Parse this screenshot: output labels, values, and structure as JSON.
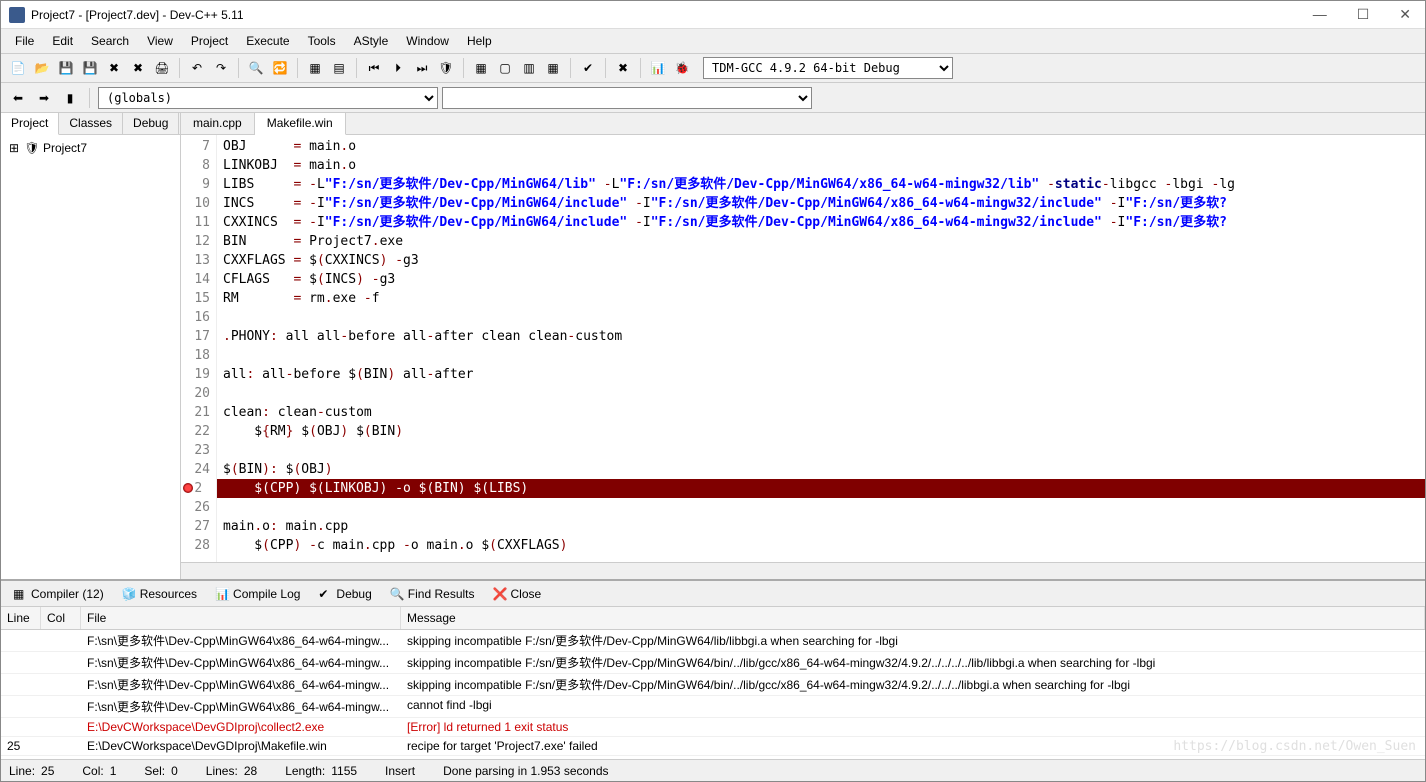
{
  "window": {
    "title": "Project7 - [Project7.dev] - Dev-C++ 5.11"
  },
  "menus": [
    "File",
    "Edit",
    "Search",
    "View",
    "Project",
    "Execute",
    "Tools",
    "AStyle",
    "Window",
    "Help"
  ],
  "compiler_select": "TDM-GCC 4.9.2 64-bit Debug",
  "scope_select": "(globals)",
  "left_tabs": [
    "Project",
    "Classes",
    "Debug"
  ],
  "project_tree_root": "Project7",
  "file_tabs": [
    "main.cpp",
    "Makefile.win"
  ],
  "active_file_tab": 1,
  "code": {
    "start": 7,
    "lines": [
      {
        "n": 7,
        "tokens": [
          {
            "t": "OBJ      ",
            "c": ""
          },
          {
            "t": "=",
            "c": "op"
          },
          {
            "t": " main",
            "c": ""
          },
          {
            "t": ".",
            "c": "punct"
          },
          {
            "t": "o",
            "c": ""
          }
        ]
      },
      {
        "n": 8,
        "tokens": [
          {
            "t": "LINKOBJ  ",
            "c": ""
          },
          {
            "t": "=",
            "c": "op"
          },
          {
            "t": " main",
            "c": ""
          },
          {
            "t": ".",
            "c": "punct"
          },
          {
            "t": "o",
            "c": ""
          }
        ]
      },
      {
        "n": 9,
        "tokens": [
          {
            "t": "LIBS     ",
            "c": ""
          },
          {
            "t": "=",
            "c": "op"
          },
          {
            "t": " ",
            "c": ""
          },
          {
            "t": "-",
            "c": "op"
          },
          {
            "t": "L",
            "c": ""
          },
          {
            "t": "\"F:/sn/更多软件/Dev-Cpp/MinGW64/lib\"",
            "c": "str"
          },
          {
            "t": " ",
            "c": ""
          },
          {
            "t": "-",
            "c": "op"
          },
          {
            "t": "L",
            "c": ""
          },
          {
            "t": "\"F:/sn/更多软件/Dev-Cpp/MinGW64/x86_64-w64-mingw32/lib\"",
            "c": "str"
          },
          {
            "t": " ",
            "c": ""
          },
          {
            "t": "-",
            "c": "op"
          },
          {
            "t": "static",
            "c": "strong"
          },
          {
            "t": "-",
            "c": "op"
          },
          {
            "t": "libgcc ",
            "c": ""
          },
          {
            "t": "-",
            "c": "op"
          },
          {
            "t": "lbgi ",
            "c": ""
          },
          {
            "t": "-",
            "c": "op"
          },
          {
            "t": "lg",
            "c": ""
          }
        ]
      },
      {
        "n": 10,
        "tokens": [
          {
            "t": "INCS     ",
            "c": ""
          },
          {
            "t": "=",
            "c": "op"
          },
          {
            "t": " ",
            "c": ""
          },
          {
            "t": "-",
            "c": "op"
          },
          {
            "t": "I",
            "c": ""
          },
          {
            "t": "\"F:/sn/更多软件/Dev-Cpp/MinGW64/include\"",
            "c": "str"
          },
          {
            "t": " ",
            "c": ""
          },
          {
            "t": "-",
            "c": "op"
          },
          {
            "t": "I",
            "c": ""
          },
          {
            "t": "\"F:/sn/更多软件/Dev-Cpp/MinGW64/x86_64-w64-mingw32/include\"",
            "c": "str"
          },
          {
            "t": " ",
            "c": ""
          },
          {
            "t": "-",
            "c": "op"
          },
          {
            "t": "I",
            "c": ""
          },
          {
            "t": "\"F:/sn/更多软?",
            "c": "str"
          }
        ]
      },
      {
        "n": 11,
        "tokens": [
          {
            "t": "CXXINCS  ",
            "c": ""
          },
          {
            "t": "=",
            "c": "op"
          },
          {
            "t": " ",
            "c": ""
          },
          {
            "t": "-",
            "c": "op"
          },
          {
            "t": "I",
            "c": ""
          },
          {
            "t": "\"F:/sn/更多软件/Dev-Cpp/MinGW64/include\"",
            "c": "str"
          },
          {
            "t": " ",
            "c": ""
          },
          {
            "t": "-",
            "c": "op"
          },
          {
            "t": "I",
            "c": ""
          },
          {
            "t": "\"F:/sn/更多软件/Dev-Cpp/MinGW64/x86_64-w64-mingw32/include\"",
            "c": "str"
          },
          {
            "t": " ",
            "c": ""
          },
          {
            "t": "-",
            "c": "op"
          },
          {
            "t": "I",
            "c": ""
          },
          {
            "t": "\"F:/sn/更多软?",
            "c": "str"
          }
        ]
      },
      {
        "n": 12,
        "tokens": [
          {
            "t": "BIN      ",
            "c": ""
          },
          {
            "t": "=",
            "c": "op"
          },
          {
            "t": " Project7",
            "c": ""
          },
          {
            "t": ".",
            "c": "punct"
          },
          {
            "t": "exe",
            "c": ""
          }
        ]
      },
      {
        "n": 13,
        "tokens": [
          {
            "t": "CXXFLAGS ",
            "c": ""
          },
          {
            "t": "=",
            "c": "op"
          },
          {
            "t": " $",
            "c": ""
          },
          {
            "t": "(",
            "c": "punct"
          },
          {
            "t": "CXXINCS",
            "c": ""
          },
          {
            "t": ")",
            "c": "punct"
          },
          {
            "t": " ",
            "c": ""
          },
          {
            "t": "-",
            "c": "op"
          },
          {
            "t": "g3",
            "c": ""
          }
        ]
      },
      {
        "n": 14,
        "tokens": [
          {
            "t": "CFLAGS   ",
            "c": ""
          },
          {
            "t": "=",
            "c": "op"
          },
          {
            "t": " $",
            "c": ""
          },
          {
            "t": "(",
            "c": "punct"
          },
          {
            "t": "INCS",
            "c": ""
          },
          {
            "t": ")",
            "c": "punct"
          },
          {
            "t": " ",
            "c": ""
          },
          {
            "t": "-",
            "c": "op"
          },
          {
            "t": "g3",
            "c": ""
          }
        ]
      },
      {
        "n": 15,
        "tokens": [
          {
            "t": "RM       ",
            "c": ""
          },
          {
            "t": "=",
            "c": "op"
          },
          {
            "t": " rm",
            "c": ""
          },
          {
            "t": ".",
            "c": "punct"
          },
          {
            "t": "exe ",
            "c": ""
          },
          {
            "t": "-",
            "c": "op"
          },
          {
            "t": "f",
            "c": ""
          }
        ]
      },
      {
        "n": 16,
        "tokens": []
      },
      {
        "n": 17,
        "tokens": [
          {
            "t": ".",
            "c": "punct"
          },
          {
            "t": "PHONY",
            "c": ""
          },
          {
            "t": ":",
            "c": "punct"
          },
          {
            "t": " all all",
            "c": ""
          },
          {
            "t": "-",
            "c": "op"
          },
          {
            "t": "before all",
            "c": ""
          },
          {
            "t": "-",
            "c": "op"
          },
          {
            "t": "after clean clean",
            "c": ""
          },
          {
            "t": "-",
            "c": "op"
          },
          {
            "t": "custom",
            "c": ""
          }
        ]
      },
      {
        "n": 18,
        "tokens": []
      },
      {
        "n": 19,
        "tokens": [
          {
            "t": "all",
            "c": ""
          },
          {
            "t": ":",
            "c": "punct"
          },
          {
            "t": " all",
            "c": ""
          },
          {
            "t": "-",
            "c": "op"
          },
          {
            "t": "before $",
            "c": ""
          },
          {
            "t": "(",
            "c": "punct"
          },
          {
            "t": "BIN",
            "c": ""
          },
          {
            "t": ")",
            "c": "punct"
          },
          {
            "t": " all",
            "c": ""
          },
          {
            "t": "-",
            "c": "op"
          },
          {
            "t": "after",
            "c": ""
          }
        ]
      },
      {
        "n": 20,
        "tokens": []
      },
      {
        "n": 21,
        "tokens": [
          {
            "t": "clean",
            "c": ""
          },
          {
            "t": ":",
            "c": "punct"
          },
          {
            "t": " clean",
            "c": ""
          },
          {
            "t": "-",
            "c": "op"
          },
          {
            "t": "custom",
            "c": ""
          }
        ]
      },
      {
        "n": 22,
        "tokens": [
          {
            "t": "    $",
            "c": ""
          },
          {
            "t": "{",
            "c": "punct"
          },
          {
            "t": "RM",
            "c": ""
          },
          {
            "t": "}",
            "c": "punct"
          },
          {
            "t": " $",
            "c": ""
          },
          {
            "t": "(",
            "c": "punct"
          },
          {
            "t": "OBJ",
            "c": ""
          },
          {
            "t": ")",
            "c": "punct"
          },
          {
            "t": " $",
            "c": ""
          },
          {
            "t": "(",
            "c": "punct"
          },
          {
            "t": "BIN",
            "c": ""
          },
          {
            "t": ")",
            "c": "punct"
          }
        ]
      },
      {
        "n": 23,
        "tokens": []
      },
      {
        "n": 24,
        "tokens": [
          {
            "t": "$",
            "c": ""
          },
          {
            "t": "(",
            "c": "punct"
          },
          {
            "t": "BIN",
            "c": ""
          },
          {
            "t": "): ",
            "c": "punct"
          },
          {
            "t": "$",
            "c": ""
          },
          {
            "t": "(",
            "c": "punct"
          },
          {
            "t": "OBJ",
            "c": ""
          },
          {
            "t": ")",
            "c": "punct"
          }
        ]
      },
      {
        "n": 25,
        "hl": true,
        "bp": true,
        "raw": "    $(CPP) $(LINKOBJ) -o $(BIN) $(LIBS)"
      },
      {
        "n": 26,
        "tokens": []
      },
      {
        "n": 27,
        "tokens": [
          {
            "t": "main",
            "c": ""
          },
          {
            "t": ".",
            "c": "punct"
          },
          {
            "t": "o",
            "c": ""
          },
          {
            "t": ":",
            "c": "punct"
          },
          {
            "t": " main",
            "c": ""
          },
          {
            "t": ".",
            "c": "punct"
          },
          {
            "t": "cpp",
            "c": ""
          }
        ]
      },
      {
        "n": 28,
        "tokens": [
          {
            "t": "    $",
            "c": ""
          },
          {
            "t": "(",
            "c": "punct"
          },
          {
            "t": "CPP",
            "c": ""
          },
          {
            "t": ")",
            "c": "punct"
          },
          {
            "t": " ",
            "c": ""
          },
          {
            "t": "-",
            "c": "op"
          },
          {
            "t": "c main",
            "c": ""
          },
          {
            "t": ".",
            "c": "punct"
          },
          {
            "t": "cpp ",
            "c": ""
          },
          {
            "t": "-",
            "c": "op"
          },
          {
            "t": "o main",
            "c": ""
          },
          {
            "t": ".",
            "c": "punct"
          },
          {
            "t": "o $",
            "c": ""
          },
          {
            "t": "(",
            "c": "punct"
          },
          {
            "t": "CXXFLAGS",
            "c": ""
          },
          {
            "t": ")",
            "c": "punct"
          }
        ]
      }
    ]
  },
  "bottom_tabs": [
    {
      "label": "Compiler (12)",
      "icon": "grid"
    },
    {
      "label": "Resources",
      "icon": "cube"
    },
    {
      "label": "Compile Log",
      "icon": "bars"
    },
    {
      "label": "Debug",
      "icon": "check"
    },
    {
      "label": "Find Results",
      "icon": "search"
    },
    {
      "label": "Close",
      "icon": "x"
    }
  ],
  "msg_headers": {
    "line": "Line",
    "col": "Col",
    "file": "File",
    "msg": "Message"
  },
  "messages": [
    {
      "line": "",
      "col": "",
      "file": "F:\\sn\\更多软件\\Dev-Cpp\\MinGW64\\x86_64-w64-mingw...",
      "msg": "skipping incompatible F:/sn/更多软件/Dev-Cpp/MinGW64/lib/libbgi.a when searching for -lbgi",
      "err": false
    },
    {
      "line": "",
      "col": "",
      "file": "F:\\sn\\更多软件\\Dev-Cpp\\MinGW64\\x86_64-w64-mingw...",
      "msg": "skipping incompatible F:/sn/更多软件/Dev-Cpp/MinGW64/bin/../lib/gcc/x86_64-w64-mingw32/4.9.2/../../../../lib/libbgi.a when searching for -lbgi",
      "err": false
    },
    {
      "line": "",
      "col": "",
      "file": "F:\\sn\\更多软件\\Dev-Cpp\\MinGW64\\x86_64-w64-mingw...",
      "msg": "skipping incompatible F:/sn/更多软件/Dev-Cpp/MinGW64/bin/../lib/gcc/x86_64-w64-mingw32/4.9.2/../../../libbgi.a when searching for -lbgi",
      "err": false
    },
    {
      "line": "",
      "col": "",
      "file": "F:\\sn\\更多软件\\Dev-Cpp\\MinGW64\\x86_64-w64-mingw...",
      "msg": "cannot find -lbgi",
      "err": false
    },
    {
      "line": "",
      "col": "",
      "file": "E:\\DevCWorkspace\\DevGDIproj\\collect2.exe",
      "msg": "[Error] ld returned 1 exit status",
      "err": true
    },
    {
      "line": "25",
      "col": "",
      "file": "E:\\DevCWorkspace\\DevGDIproj\\Makefile.win",
      "msg": "recipe for target 'Project7.exe' failed",
      "err": false
    }
  ],
  "status": {
    "line_lbl": "Line:",
    "line": "25",
    "col_lbl": "Col:",
    "col": "1",
    "sel_lbl": "Sel:",
    "sel": "0",
    "lines_lbl": "Lines:",
    "lines": "28",
    "length_lbl": "Length:",
    "length": "1155",
    "mode": "Insert",
    "parse": "Done parsing in 1.953 seconds"
  },
  "watermark": "https://blog.csdn.net/Owen_Suen"
}
